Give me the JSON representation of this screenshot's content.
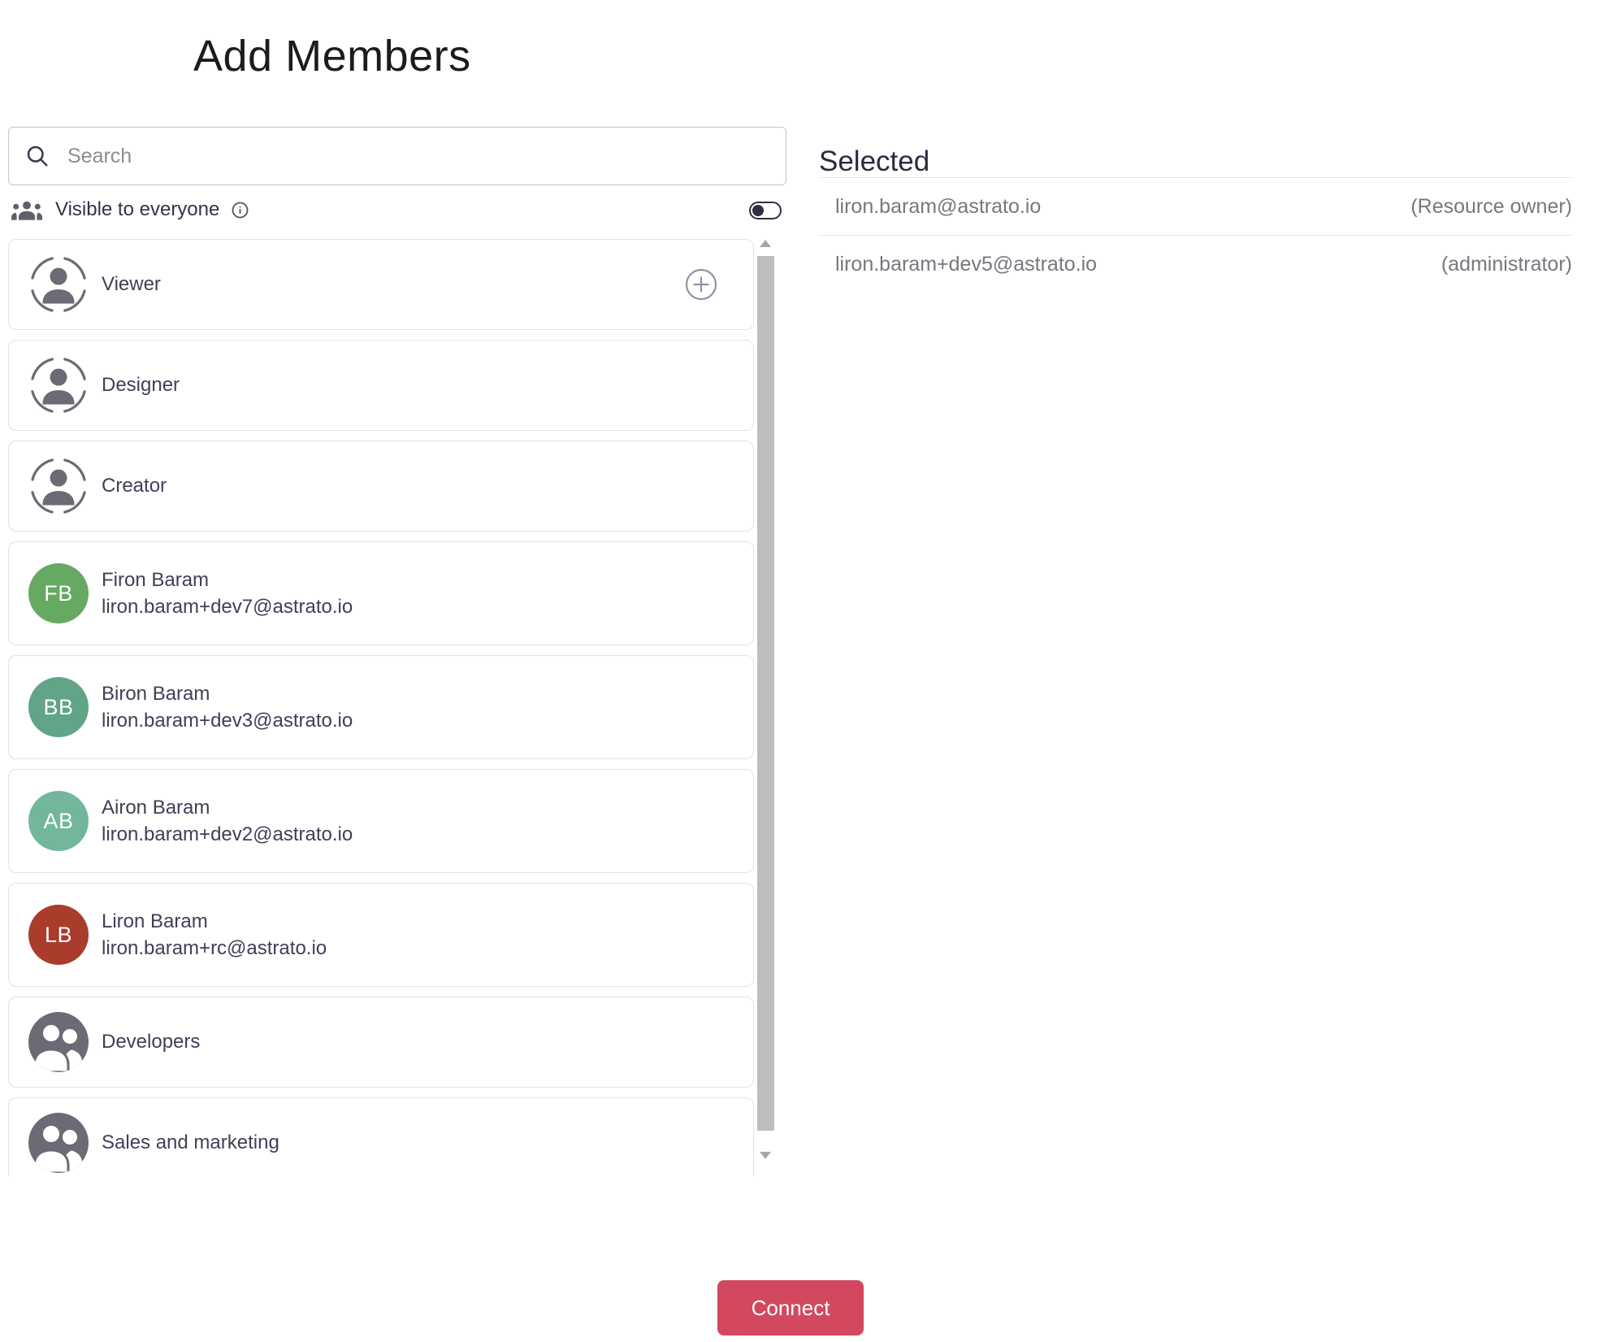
{
  "title": "Add Members",
  "search": {
    "placeholder": "Search"
  },
  "visibility": {
    "label": "Visible to everyone",
    "toggle_on": false
  },
  "list": [
    {
      "type": "role",
      "label": "Viewer",
      "has_add_button": true
    },
    {
      "type": "role",
      "label": "Designer"
    },
    {
      "type": "role",
      "label": "Creator"
    },
    {
      "type": "user",
      "initials": "FB",
      "name": "Firon Baram",
      "email": "liron.baram+dev7@astrato.io",
      "color": "#66a963"
    },
    {
      "type": "user",
      "initials": "BB",
      "name": "Biron Baram",
      "email": "liron.baram+dev3@astrato.io",
      "color": "#61a487"
    },
    {
      "type": "user",
      "initials": "AB",
      "name": "Airon Baram",
      "email": "liron.baram+dev2@astrato.io",
      "color": "#72b79b"
    },
    {
      "type": "user",
      "initials": "LB",
      "name": "Liron Baram",
      "email": "liron.baram+rc@astrato.io",
      "color": "#a93c2b"
    },
    {
      "type": "group",
      "label": "Developers"
    },
    {
      "type": "group",
      "label": "Sales and marketing"
    }
  ],
  "selected": {
    "heading": "Selected",
    "items": [
      {
        "email": "liron.baram@astrato.io",
        "role": "(Resource owner)"
      },
      {
        "email": "liron.baram+dev5@astrato.io",
        "role": "(administrator)"
      }
    ]
  },
  "footer": {
    "connect_label": "Connect"
  },
  "icons": {
    "search": "magnifier",
    "visibility": "people-group",
    "info": "circled-i",
    "role_avatar": "person-in-dashed-ring",
    "group_avatar": "two-people-filled-circle",
    "add": "circled-plus",
    "scroll_up": "triangle-up",
    "scroll_down": "triangle-down"
  },
  "colors": {
    "accent_red": "#d2485f",
    "toggle": "#2e2e45",
    "icon_gray": "#6b6b75",
    "scrollbar_thumb": "#bdbdbd",
    "card_border": "#e2e2e6",
    "muted_text": "#77777f",
    "dark_text": "#3f3f58"
  }
}
